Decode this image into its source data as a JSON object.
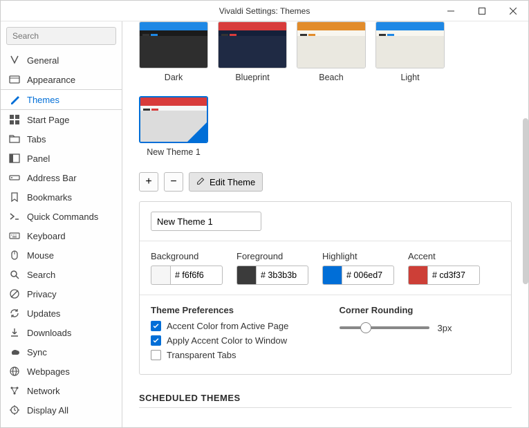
{
  "window": {
    "title": "Vivaldi Settings: Themes"
  },
  "search": {
    "placeholder": "Search"
  },
  "nav": [
    {
      "icon": "vivaldi",
      "label": "General"
    },
    {
      "icon": "appearance",
      "label": "Appearance"
    },
    {
      "icon": "themes",
      "label": "Themes",
      "active": true
    },
    {
      "icon": "startpage",
      "label": "Start Page"
    },
    {
      "icon": "tabs",
      "label": "Tabs"
    },
    {
      "icon": "panel",
      "label": "Panel"
    },
    {
      "icon": "addressbar",
      "label": "Address Bar"
    },
    {
      "icon": "bookmarks",
      "label": "Bookmarks"
    },
    {
      "icon": "quickcommands",
      "label": "Quick Commands"
    },
    {
      "icon": "keyboard",
      "label": "Keyboard"
    },
    {
      "icon": "mouse",
      "label": "Mouse"
    },
    {
      "icon": "search",
      "label": "Search"
    },
    {
      "icon": "privacy",
      "label": "Privacy"
    },
    {
      "icon": "updates",
      "label": "Updates"
    },
    {
      "icon": "downloads",
      "label": "Downloads"
    },
    {
      "icon": "sync",
      "label": "Sync"
    },
    {
      "icon": "webpages",
      "label": "Webpages"
    },
    {
      "icon": "network",
      "label": "Network"
    },
    {
      "icon": "displayall",
      "label": "Display All"
    }
  ],
  "themesTop": [
    {
      "name": "Dark",
      "bg": "#2e2e2e",
      "hdr": "#1b1b1b",
      "accent": "#1e88e5"
    },
    {
      "name": "Blueprint",
      "bg": "#1f2a44",
      "hdr": "#14203a",
      "accent": "#d83b3b"
    },
    {
      "name": "Beach",
      "bg": "#eae8e0",
      "hdr": "#f8f6ef",
      "accent": "#e28c2b"
    },
    {
      "name": "Light",
      "bg": "#eae8e0",
      "hdr": "#f8f6ef",
      "accent": "#1e88e5"
    }
  ],
  "customTheme": {
    "name": "New Theme 1",
    "bg": "#dcdcdc",
    "hdr": "#f6f6f6",
    "accent": "#d83b3b",
    "selected": true
  },
  "toolbar": {
    "add": "+",
    "remove": "−",
    "edit": "Edit Theme"
  },
  "nameField": {
    "value": "New Theme 1"
  },
  "colors": {
    "bg": {
      "label": "Background",
      "value": "f6f6f6",
      "swatch": "#f6f6f6"
    },
    "fg": {
      "label": "Foreground",
      "value": "3b3b3b",
      "swatch": "#3b3b3b"
    },
    "hl": {
      "label": "Highlight",
      "value": "006ed7",
      "swatch": "#006ed7"
    },
    "ac": {
      "label": "Accent",
      "value": "cd3f37",
      "swatch": "#cd3f37"
    }
  },
  "prefs": {
    "title": "Theme Preferences",
    "items": [
      {
        "label": "Accent Color from Active Page",
        "checked": true
      },
      {
        "label": "Apply Accent Color to Window",
        "checked": true
      },
      {
        "label": "Transparent Tabs",
        "checked": false
      }
    ],
    "rounding": {
      "title": "Corner Rounding",
      "value": "3px"
    }
  },
  "scheduled": {
    "heading": "SCHEDULED THEMES"
  }
}
